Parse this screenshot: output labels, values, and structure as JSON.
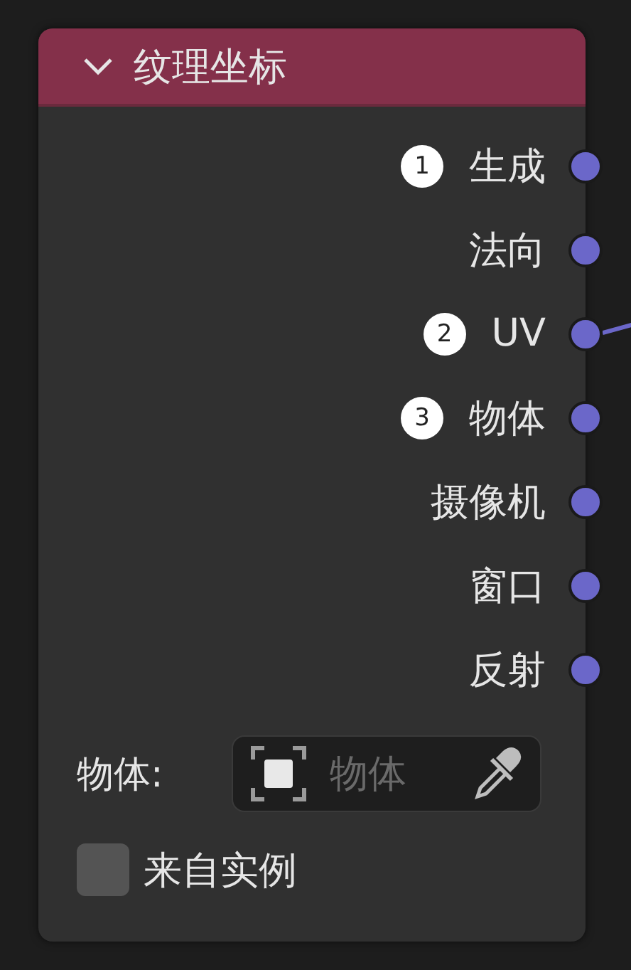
{
  "node": {
    "title": "纹理坐标",
    "expanded": true
  },
  "outputs": [
    {
      "label": "生成",
      "badge": "1",
      "linked": false
    },
    {
      "label": "法向",
      "linked": false
    },
    {
      "label": "UV",
      "badge": "2",
      "linked": true
    },
    {
      "label": "物体",
      "badge": "3",
      "linked": false
    },
    {
      "label": "摄像机",
      "linked": false
    },
    {
      "label": "窗口",
      "linked": false
    },
    {
      "label": "反射",
      "linked": false
    }
  ],
  "object_field": {
    "label": "物体:",
    "placeholder": "物体"
  },
  "from_instancer": {
    "label": "来自实例",
    "checked": false
  }
}
